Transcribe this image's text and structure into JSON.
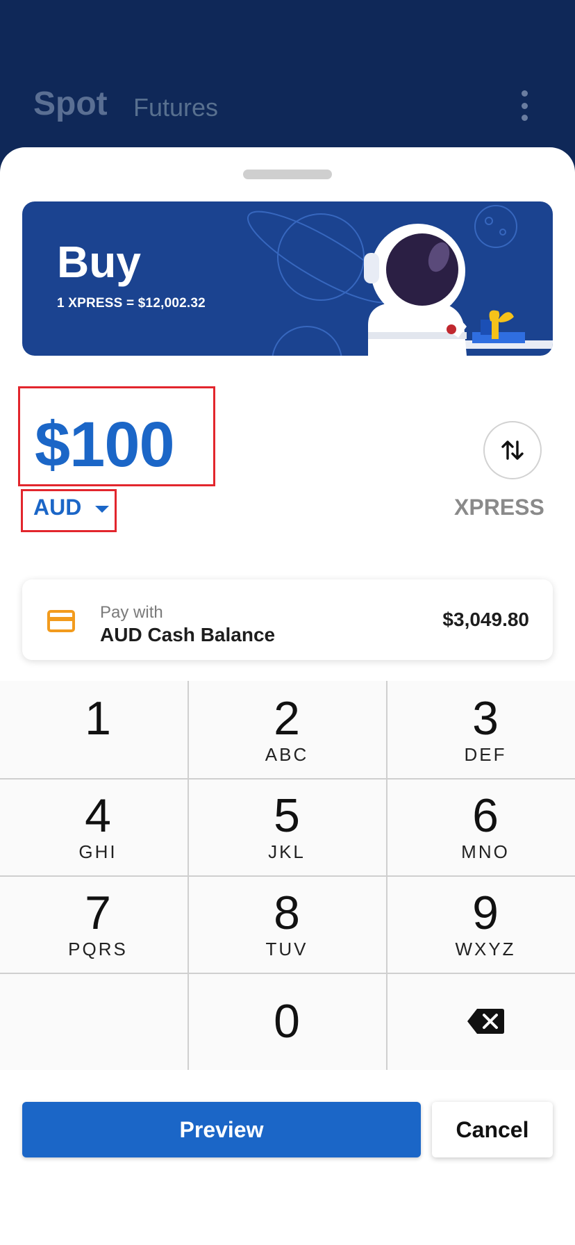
{
  "header": {
    "tabs": [
      {
        "label": "Spot",
        "active": true
      },
      {
        "label": "Futures",
        "active": false
      }
    ],
    "more_icon": "more-vertical-icon"
  },
  "banner": {
    "title": "Buy",
    "rate": "1 XPRESS = $12,002.32",
    "colors": {
      "background": "#1b4390"
    }
  },
  "order": {
    "amount": "$100",
    "currency": "AUD",
    "target_asset": "XPRESS",
    "swap_icon": "swap-vertical-icon"
  },
  "payment": {
    "caption": "Pay with",
    "source": "AUD Cash Balance",
    "balance": "$3,049.80",
    "icon": "credit-card-icon"
  },
  "keypad": {
    "keys": [
      {
        "num": "1",
        "letters": ""
      },
      {
        "num": "2",
        "letters": "ABC"
      },
      {
        "num": "3",
        "letters": "DEF"
      },
      {
        "num": "4",
        "letters": "GHI"
      },
      {
        "num": "5",
        "letters": "JKL"
      },
      {
        "num": "6",
        "letters": "MNO"
      },
      {
        "num": "7",
        "letters": "PQRS"
      },
      {
        "num": "8",
        "letters": "TUV"
      },
      {
        "num": "9",
        "letters": "WXYZ"
      },
      {
        "num": "",
        "letters": ""
      },
      {
        "num": "0",
        "letters": ""
      },
      {
        "num": "",
        "letters": "",
        "icon": "backspace-icon"
      }
    ]
  },
  "actions": {
    "preview_label": "Preview",
    "cancel_label": "Cancel",
    "colors": {
      "primary": "#1b66c7"
    }
  }
}
